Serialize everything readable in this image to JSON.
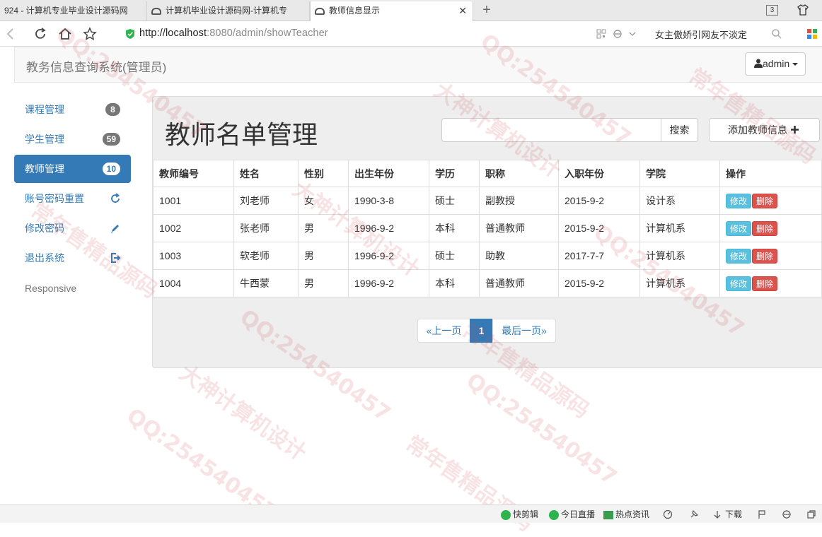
{
  "browser": {
    "tabs": [
      {
        "label": "924 - 计算机专业毕业设计源码网"
      },
      {
        "label": "计算机毕业设计源码网-计算机专"
      },
      {
        "label": "教师信息显示"
      }
    ],
    "tab_count": "3",
    "url_host": "http://localhost",
    "url_rest": ":8080/admin/showTeacher",
    "search_hint": "女主傲娇引网友不淡定"
  },
  "app": {
    "brand": "教务信息查询系统(管理员)",
    "user": "admin"
  },
  "sidebar": {
    "items": [
      {
        "label": "课程管理",
        "badge": "8"
      },
      {
        "label": "学生管理",
        "badge": "59"
      },
      {
        "label": "教师管理",
        "badge": "10"
      },
      {
        "label": "账号密码重置"
      },
      {
        "label": "修改密码"
      },
      {
        "label": "退出系统"
      }
    ],
    "footer": "Responsive"
  },
  "panel": {
    "title": "教师名单管理",
    "search_button": "搜索",
    "add_button": "添加教师信息"
  },
  "table": {
    "headers": [
      "教师编号",
      "姓名",
      "性别",
      "出生年份",
      "学历",
      "职称",
      "入职年份",
      "学院",
      "操作"
    ],
    "rows": [
      [
        "1001",
        "刘老师",
        "女",
        "1990-3-8",
        "硕士",
        "副教授",
        "2015-9-2",
        "设计系"
      ],
      [
        "1002",
        "张老师",
        "男",
        "1996-9-2",
        "本科",
        "普通教师",
        "2015-9-2",
        "计算机系"
      ],
      [
        "1003",
        "软老师",
        "男",
        "1996-9-2",
        "硕士",
        "助教",
        "2017-7-7",
        "计算机系"
      ],
      [
        "1004",
        "牛西蒙",
        "男",
        "1996-9-2",
        "本科",
        "普通教师",
        "2015-9-2",
        "计算机系"
      ]
    ],
    "edit_label": "修改",
    "delete_label": "删除"
  },
  "pagination": {
    "prev": "«上一页",
    "current": "1",
    "last": "最后一页»"
  },
  "statusbar": {
    "items": [
      "快剪辑",
      "今日直播",
      "热点资讯",
      "下载"
    ]
  },
  "watermark": {
    "texts": [
      "大神计算机设计",
      "QQ:254540457",
      "常年售精品源码"
    ]
  },
  "colors": {
    "primary": "#337ab7",
    "info": "#5bc0de",
    "danger": "#d9534f",
    "badge": "#777777"
  }
}
